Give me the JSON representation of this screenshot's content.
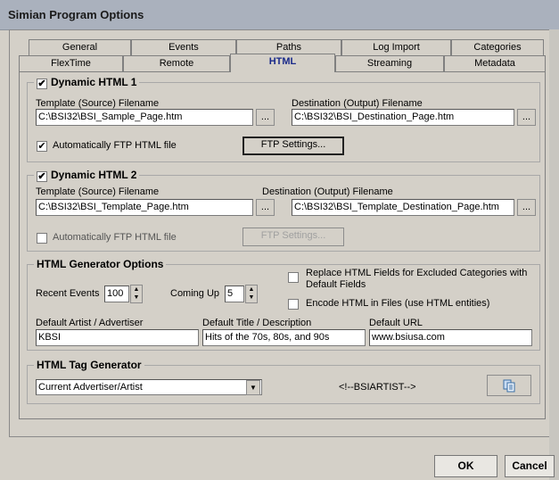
{
  "window": {
    "title": "Simian Program Options"
  },
  "tabs_row1": [
    "General",
    "Events",
    "Paths",
    "Log Import",
    "Categories"
  ],
  "tabs_row2": [
    "FlexTime",
    "Remote",
    "HTML",
    "Streaming",
    "Metadata"
  ],
  "active_tab": "HTML",
  "dynamic1": {
    "title": "Dynamic HTML 1",
    "checked_mark": "✔",
    "template_label": "Template (Source) Filename",
    "template_value": "C:\\BSI32\\BSI_Sample_Page.htm",
    "dest_label": "Destination (Output) Filename",
    "dest_value": "C:\\BSI32\\BSI_Destination_Page.htm",
    "browse": "...",
    "ftp_label": "Automatically FTP HTML file",
    "ftp_checked": "✔",
    "ftp_settings": "FTP Settings..."
  },
  "dynamic2": {
    "title": "Dynamic HTML 2",
    "checked_mark": "✔",
    "template_label": "Template (Source) Filename",
    "template_value": "C:\\BSI32\\BSI_Template_Page.htm",
    "dest_label": "Destination (Output) Filename",
    "dest_value": "C:\\BSI32\\BSI_Template_Destination_Page.htm",
    "browse": "...",
    "ftp_label": "Automatically FTP HTML file",
    "ftp_settings": "FTP Settings..."
  },
  "generator": {
    "title": "HTML Generator Options",
    "recent_label": "Recent Events",
    "recent_value": "100",
    "coming_label": "Coming Up",
    "coming_value": "5",
    "replace_label_1": "Replace HTML Fields for Excluded Categories with",
    "replace_label_2": "Default Fields",
    "encode_label": "Encode HTML in Files (use HTML entities)",
    "artist_label": "Default Artist / Advertiser",
    "artist_value": "KBSI",
    "title_label": "Default Title / Description",
    "title_value": "Hits of the 70s, 80s, and 90s",
    "url_label": "Default URL",
    "url_value": "www.bsiusa.com"
  },
  "tag_generator": {
    "title": "HTML Tag Generator",
    "selected": "Current Advertiser/Artist",
    "tag_text": "<!--BSIARTIST-->",
    "copy_icon": "clipboard-copy-icon"
  },
  "buttons": {
    "ok": "OK",
    "cancel": "Cancel"
  }
}
